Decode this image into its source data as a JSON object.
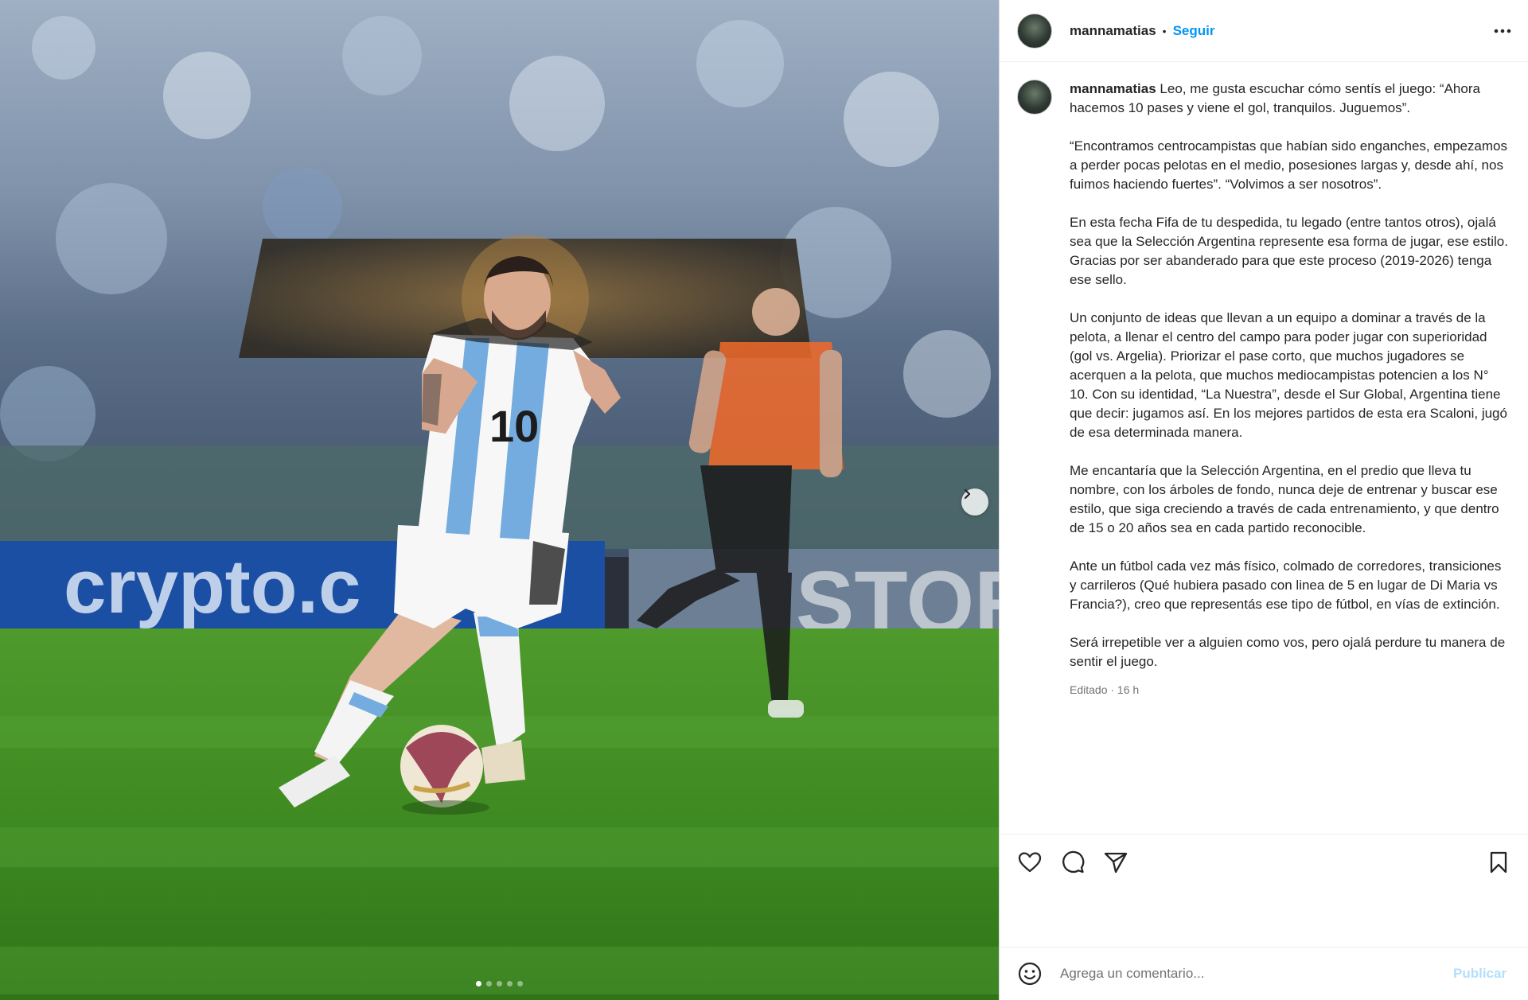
{
  "post": {
    "username": "mannamatias",
    "separator": "•",
    "follow_label": "Seguir",
    "more_icon": "more-options-icon"
  },
  "caption": {
    "username": "mannamatias",
    "paragraphs": [
      "Leo, me gusta escuchar cómo sentís el juego: “Ahora hacemos 10 pases y viene el gol, tranquilos. Juguemos”.",
      "“Encontramos centrocampistas que habían sido enganches, empezamos a perder pocas pelotas en el medio, posesiones largas y, desde ahí, nos fuimos haciendo fuertes”. “Volvimos a ser nosotros”.",
      "En esta fecha Fifa de tu despedida, tu legado (entre tantos otros), ojalá sea que la Selección Argentina represente esa forma de jugar, ese estilo. Gracias por ser abanderado para que este proceso (2019-2026) tenga ese sello.",
      "Un conjunto de ideas que llevan a un equipo a dominar a través de la pelota, a llenar el centro del campo para poder jugar con superioridad (gol vs. Argelia). Priorizar el pase corto, que muchos jugadores se acerquen a la pelota, que muchos mediocampistas potencien a los N° 10. Con su identidad, “La Nuestra”, desde el Sur Global, Argentina tiene que decir: jugamos así. En los mejores partidos de esta era Scaloni, jugó de esa determinada manera.",
      "Me encantaría que la Selección Argentina, en el predio que lleva tu nombre, con los árboles de fondo, nunca deje de entrenar y buscar ese estilo, que siga creciendo a través de cada entrenamiento, y que dentro de 15 o 20 años sea en cada partido reconocible.",
      "Ante un fútbol cada vez más físico, colmado de corredores, transiciones y carrileros (Qué hubiera pasado con linea de 5 en lugar de Di Maria vs Francia?), creo que representás ese tipo de fútbol, en vías de extinción.",
      "Será irrepetible ver a alguien como vos, pero ojalá perdure tu manera de sentir el juego."
    ],
    "meta": "Editado · 16 h"
  },
  "media": {
    "jersey_number": "10",
    "banner_left": "crypto.c",
    "banner_right": "STORE",
    "carousel_count": 5,
    "carousel_active": 1
  },
  "actions": {
    "like_icon": "heart-icon",
    "comment_icon": "comment-icon",
    "share_icon": "share-icon",
    "save_icon": "bookmark-icon"
  },
  "comment": {
    "placeholder": "Agrega un comentario...",
    "publish_label": "Publicar",
    "emoji_icon": "emoji-icon"
  }
}
